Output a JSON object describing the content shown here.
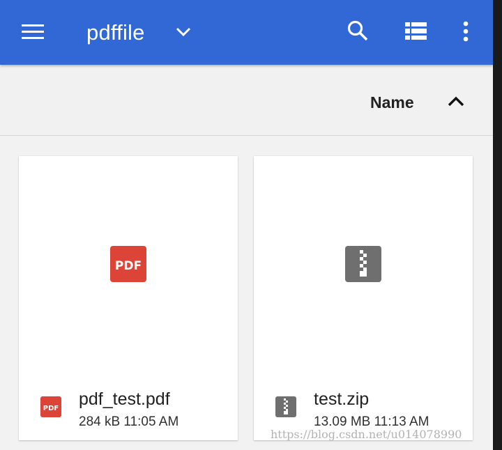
{
  "appbar": {
    "title": "pdffile",
    "icons": [
      "menu-icon",
      "chevron-down-icon",
      "search-icon",
      "list-view-icon",
      "more-vert-icon"
    ],
    "color": "#3267d6"
  },
  "sort": {
    "label": "Name",
    "direction_icon": "chevron-up-icon"
  },
  "files": [
    {
      "name": "pdf_test.pdf",
      "meta": "284 kB 11:05 AM",
      "icon": "pdf-file-icon",
      "icon_color": "#dc4437"
    },
    {
      "name": "test.zip",
      "meta": "13.09 MB 11:13 AM",
      "icon": "zip-file-icon",
      "icon_color": "#6f6f6f"
    }
  ],
  "watermark": "https://blog.csdn.net/u014078990"
}
